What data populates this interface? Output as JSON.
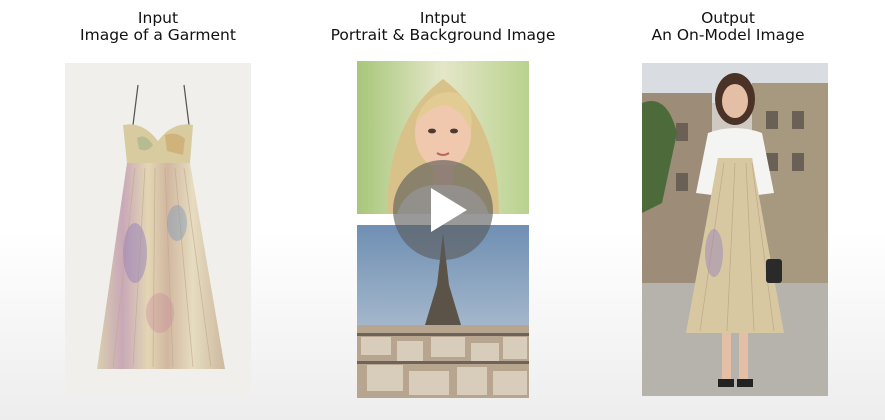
{
  "columns": [
    {
      "heading": "Input",
      "subheading": "Image of a Garment"
    },
    {
      "heading": "Intput",
      "subheading": "Portrait & Background Image"
    },
    {
      "heading": "Output",
      "subheading": "An On-Model Image"
    }
  ],
  "video": {
    "play_icon": "play-icon"
  }
}
